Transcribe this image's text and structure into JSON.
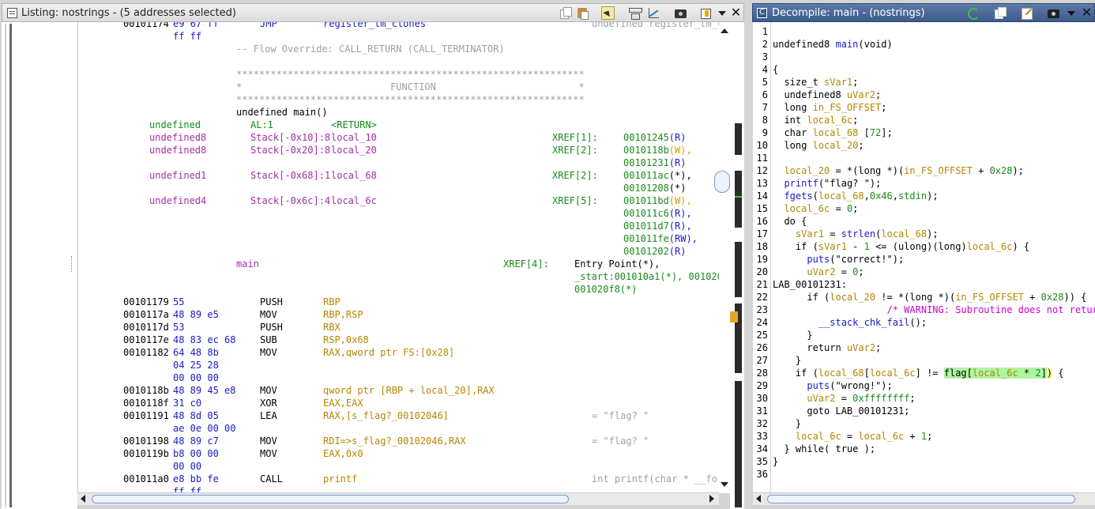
{
  "listing": {
    "title": "Listing:  nostrings - (5 addresses selected)",
    "top_partial": {
      "addr": "00101174",
      "bytes": "e9 67 ff",
      "mnem": "JMP",
      "op": "register_tm_clones",
      "cmt": "undefined register_tm_c"
    },
    "lines": [
      {
        "bytes": "ff ff"
      },
      {
        "comment": "-- Flow Override: CALL_RETURN (CALL_TERMINATOR)"
      },
      {
        "stars": "*************************************************************"
      },
      {
        "funchdr": "*                          FUNCTION                         *"
      },
      {
        "stars": "*************************************************************"
      },
      {
        "sig": "undefined main()"
      }
    ],
    "vars": [
      {
        "type": "undefined",
        "loc": "AL:1",
        "name": "<RETURN>"
      },
      {
        "type": "undefined8",
        "loc": "Stack[-0x10]:8",
        "name": "local_10",
        "xref": "XREF[1]:",
        "refs": [
          [
            "00101245",
            "(R)"
          ]
        ]
      },
      {
        "type": "undefined8",
        "loc": "Stack[-0x20]:8",
        "name": "local_20",
        "xref": "XREF[2]:",
        "refs": [
          [
            "0010118b",
            "(W),"
          ],
          [
            "00101231",
            "(R)"
          ]
        ]
      },
      {
        "type": "undefined1",
        "loc": "Stack[-0x68]:1",
        "name": "local_68",
        "xref": "XREF[2]:",
        "refs": [
          [
            "001011ac",
            "(*),"
          ],
          [
            "00101208",
            "(*)"
          ]
        ]
      },
      {
        "type": "undefined4",
        "loc": "Stack[-0x6c]:4",
        "name": "local_6c",
        "xref": "XREF[5]:",
        "refs": [
          [
            "001011bd",
            "(W),"
          ],
          [
            "001011c6",
            "(R),"
          ],
          [
            "001011d7",
            "(R),"
          ],
          [
            "001011fe",
            "(RW),"
          ],
          [
            "00101202",
            "(R)"
          ]
        ]
      }
    ],
    "label": {
      "name": "main",
      "xref": "XREF[4]:",
      "refs": [
        "Entry Point(*),",
        "_start:001010a1(*), 001020",
        "001020f8(*)"
      ]
    },
    "insns": [
      {
        "addr": "00101179",
        "bytes": "55",
        "mnem": "PUSH",
        "op": "RBP"
      },
      {
        "addr": "0010117a",
        "bytes": "48 89 e5",
        "mnem": "MOV",
        "op": "RBP,RSP"
      },
      {
        "addr": "0010117d",
        "bytes": "53",
        "mnem": "PUSH",
        "op": "RBX"
      },
      {
        "addr": "0010117e",
        "bytes": "48 83 ec 68",
        "mnem": "SUB",
        "op": "RSP,0x68"
      },
      {
        "addr": "00101182",
        "bytes": "64 48 8b",
        "mnem": "MOV",
        "op": "RAX,qword ptr FS:[0x28]"
      },
      {
        "addr": "",
        "bytes": "04 25 28",
        "mnem": "",
        "op": ""
      },
      {
        "addr": "",
        "bytes": "00 00 00",
        "mnem": "",
        "op": ""
      },
      {
        "addr": "0010118b",
        "bytes": "48 89 45 e8",
        "mnem": "MOV",
        "op": "qword ptr [RBP + local_20],RAX"
      },
      {
        "addr": "0010118f",
        "bytes": "31 c0",
        "mnem": "XOR",
        "op": "EAX,EAX"
      },
      {
        "addr": "00101191",
        "bytes": "48 8d 05",
        "mnem": "LEA",
        "op": "RAX,[s_flag?_00102046]",
        "cmt": "= \"flag? \""
      },
      {
        "addr": "",
        "bytes": "ae 0e 00 00",
        "mnem": "",
        "op": ""
      },
      {
        "addr": "00101198",
        "bytes": "48 89 c7",
        "mnem": "MOV",
        "op": "RDI=>s_flag?_00102046,RAX",
        "cmt": "= \"flag? \""
      },
      {
        "addr": "0010119b",
        "bytes": "b8 00 00",
        "mnem": "MOV",
        "op": "EAX,0x0"
      },
      {
        "addr": "",
        "bytes": "00 00",
        "mnem": "",
        "op": ""
      },
      {
        "addr": "001011a0",
        "bytes": "e8 bb fe",
        "mnem": "CALL",
        "op": "printf",
        "cmt": "int printf(char * __for"
      },
      {
        "addr": "",
        "bytes": "ff ff",
        "mnem": "",
        "op": ""
      }
    ]
  },
  "decompile": {
    "title": "Decompile: main -  (nostrings)",
    "lines": [
      "",
      "undefined8 main(void)",
      "",
      "{",
      "  size_t sVar1;",
      "  undefined8 uVar2;",
      "  long in_FS_OFFSET;",
      "  int local_6c;",
      "  char local_68 [72];",
      "  long local_20;",
      "  ",
      "  local_20 = *(long *)(in_FS_OFFSET + 0x28);",
      "  printf(\"flag? \");",
      "  fgets(local_68,0x46,stdin);",
      "  local_6c = 0;",
      "  do {",
      "    sVar1 = strlen(local_68);",
      "    if (sVar1 - 1 <= (ulong)(long)local_6c) {",
      "      puts(\"correct!\");",
      "      uVar2 = 0;",
      "LAB_00101231:",
      "      if (local_20 != *(long *)(in_FS_OFFSET + 0x28)) {",
      "                    /* WARNING: Subroutine does not return */",
      "        __stack_chk_fail();",
      "      }",
      "      return uVar2;",
      "    }",
      "    if (local_68[local_6c] != flag[local_6c * 2]) {",
      "      puts(\"wrong!\");",
      "      uVar2 = 0xffffffff;",
      "      goto LAB_00101231;",
      "    }",
      "    local_6c = local_6c + 1;",
      "  } while( true );",
      "}",
      ""
    ]
  }
}
